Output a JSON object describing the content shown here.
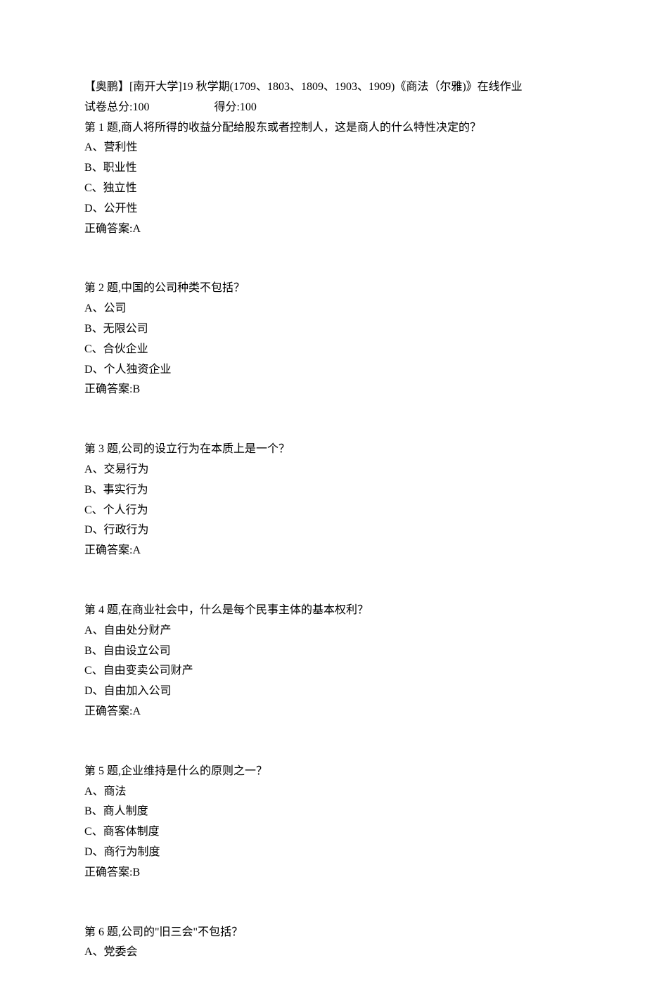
{
  "header": {
    "title": "【奥鹏】[南开大学]19 秋学期(1709、1803、1809、1903、1909)《商法（尔雅)》在线作业",
    "total_score_label": "试卷总分:100",
    "score_label": "得分:100"
  },
  "questions": [
    {
      "prompt": "第 1 题,商人将所得的收益分配给股东或者控制人，这是商人的什么特性决定的？",
      "options": [
        "A、营利性",
        "B、职业性",
        "C、独立性",
        "D、公开性"
      ],
      "answer": "正确答案:A"
    },
    {
      "prompt": "第 2 题,中国的公司种类不包括？",
      "options": [
        "A、公司",
        "B、无限公司",
        "C、合伙企业",
        "D、个人独资企业"
      ],
      "answer": "正确答案:B"
    },
    {
      "prompt": "第 3 题,公司的设立行为在本质上是一个？",
      "options": [
        "A、交易行为",
        "B、事实行为",
        "C、个人行为",
        "D、行政行为"
      ],
      "answer": "正确答案:A"
    },
    {
      "prompt": "第 4 题,在商业社会中，什么是每个民事主体的基本权利？",
      "options": [
        "A、自由处分财产",
        "B、自由设立公司",
        "C、自由变卖公司财产",
        "D、自由加入公司"
      ],
      "answer": "正确答案:A"
    },
    {
      "prompt": "第 5 题,企业维持是什么的原则之一？",
      "options": [
        "A、商法",
        "B、商人制度",
        "C、商客体制度",
        "D、商行为制度"
      ],
      "answer": "正确答案:B"
    },
    {
      "prompt": "第 6 题,公司的\"旧三会\"不包括？",
      "options": [
        "A、党委会"
      ],
      "answer": ""
    }
  ]
}
